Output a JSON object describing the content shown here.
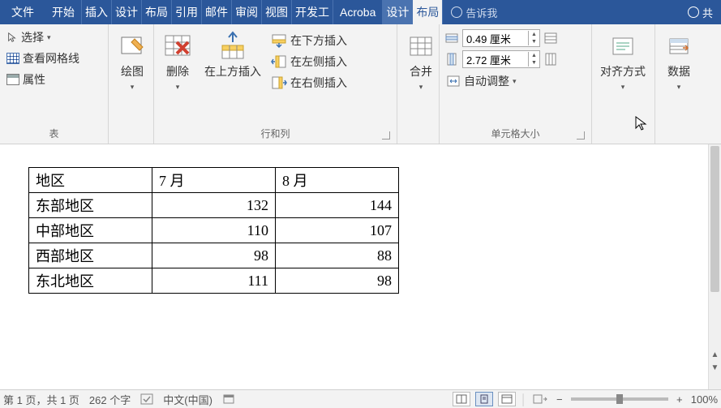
{
  "menubar": {
    "file": "文件",
    "tabs": [
      "开始",
      "插入",
      "设计",
      "布局",
      "引用",
      "邮件",
      "审阅",
      "视图",
      "开发工",
      "Acroba",
      "设计",
      "布局"
    ],
    "active_index": 11,
    "tell_me": "告诉我",
    "share": "共"
  },
  "ribbon": {
    "table_group": {
      "label": "表",
      "select": "选择",
      "view_gridlines": "查看网格线",
      "properties": "属性"
    },
    "draw_group": {
      "draw": "绘图"
    },
    "rowcol_group": {
      "label": "行和列",
      "delete": "删除",
      "insert_above": "在上方插入",
      "insert_below": "在下方插入",
      "insert_left": "在左侧插入",
      "insert_right": "在右侧插入"
    },
    "merge_group": {
      "merge": "合并"
    },
    "size_group": {
      "label": "单元格大小",
      "height": "0.49 厘米",
      "width": "2.72 厘米",
      "autofit": "自动调整"
    },
    "align_group": {
      "align": "对齐方式"
    },
    "data_group": {
      "data": "数据"
    }
  },
  "chart_data": {
    "type": "table",
    "headers": [
      "地区",
      "7 月",
      "8 月"
    ],
    "rows": [
      {
        "region": "东部地区",
        "jul": 132,
        "aug": 144
      },
      {
        "region": "中部地区",
        "jul": 110,
        "aug": 107
      },
      {
        "region": "西部地区",
        "jul": 98,
        "aug": 88
      },
      {
        "region": "东北地区",
        "jul": 111,
        "aug": 98
      }
    ]
  },
  "statusbar": {
    "page": "第 1 页，共 1 页",
    "words": "262 个字",
    "lang": "中文(中国)",
    "zoom": "100%"
  }
}
